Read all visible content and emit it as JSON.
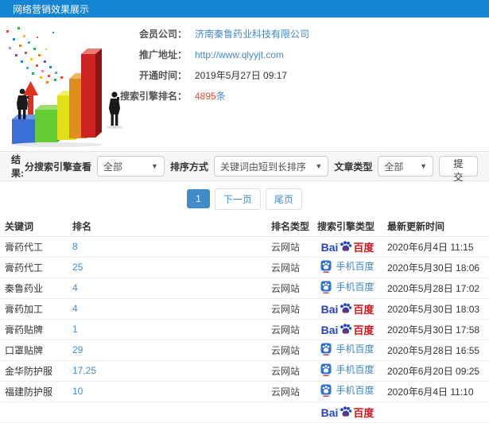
{
  "header": {
    "title": "网络营销效果展示"
  },
  "info": {
    "rows": [
      {
        "label": "会员公司：",
        "value": "济南秦鲁药业科技有限公司"
      },
      {
        "label": "推广地址：",
        "value": "http://www.qlyyjt.com"
      },
      {
        "label": "开通时间：",
        "value": "2019年5月27日 09:17"
      },
      {
        "label": "搜索引擎排名：",
        "value": "4895",
        "suffix": "条"
      }
    ]
  },
  "filters": {
    "result_label": "结果:",
    "engine_label": "分搜索引擎查看",
    "engine_value": "全部",
    "sort_label": "排序方式",
    "sort_value": "关键词由短到长排序",
    "article_label": "文章类型",
    "article_value": "全部",
    "submit_label": "提交",
    "caret": "▼"
  },
  "pagination": {
    "current": "1",
    "next": "下一页",
    "last": "尾页"
  },
  "table": {
    "headers": [
      "关键词",
      "排名",
      "排名类型",
      "搜索引擎类型",
      "最新更新时间"
    ],
    "baidu_logo": {
      "bai": "Bai",
      "du": "du",
      "cn": "百度"
    },
    "mobile_logo": {
      "text": "手机百度"
    },
    "rows": [
      {
        "keyword": "膏药代工",
        "rank": "8",
        "rank_type": "云网站",
        "engine": "baidu",
        "time": "2020年6月4日 11:15"
      },
      {
        "keyword": "膏药代工",
        "rank": "25",
        "rank_type": "云网站",
        "engine": "mobile",
        "time": "2020年5月30日 18:06"
      },
      {
        "keyword": "秦鲁药业",
        "rank": "4",
        "rank_type": "云网站",
        "engine": "mobile",
        "time": "2020年5月28日 17:02"
      },
      {
        "keyword": "膏药加工",
        "rank": "4",
        "rank_type": "云网站",
        "engine": "baidu",
        "time": "2020年5月30日 18:03"
      },
      {
        "keyword": "膏药贴牌",
        "rank": "1",
        "rank_type": "云网站",
        "engine": "baidu",
        "time": "2020年5月30日 17:58"
      },
      {
        "keyword": "口罩贴牌",
        "rank": "29",
        "rank_type": "云网站",
        "engine": "mobile",
        "time": "2020年5月28日 16:55"
      },
      {
        "keyword": "金华防护服",
        "rank": "17,25",
        "rank_type": "云网站",
        "engine": "mobile",
        "time": "2020年6月20日 09:25"
      },
      {
        "keyword": "福建防护服",
        "rank": "10",
        "rank_type": "云网站",
        "engine": "mobile",
        "time": "2020年6月4日 11:10"
      },
      {
        "keyword": "",
        "rank": "",
        "rank_type": "",
        "engine": "baidu",
        "time": ""
      }
    ]
  },
  "colors": {
    "header_blue": "#1585d3",
    "link_blue": "#428bca",
    "highlight_red": "#ee4433",
    "baidu_blue": "#2543c0",
    "baidu_red": "#d6131d"
  }
}
